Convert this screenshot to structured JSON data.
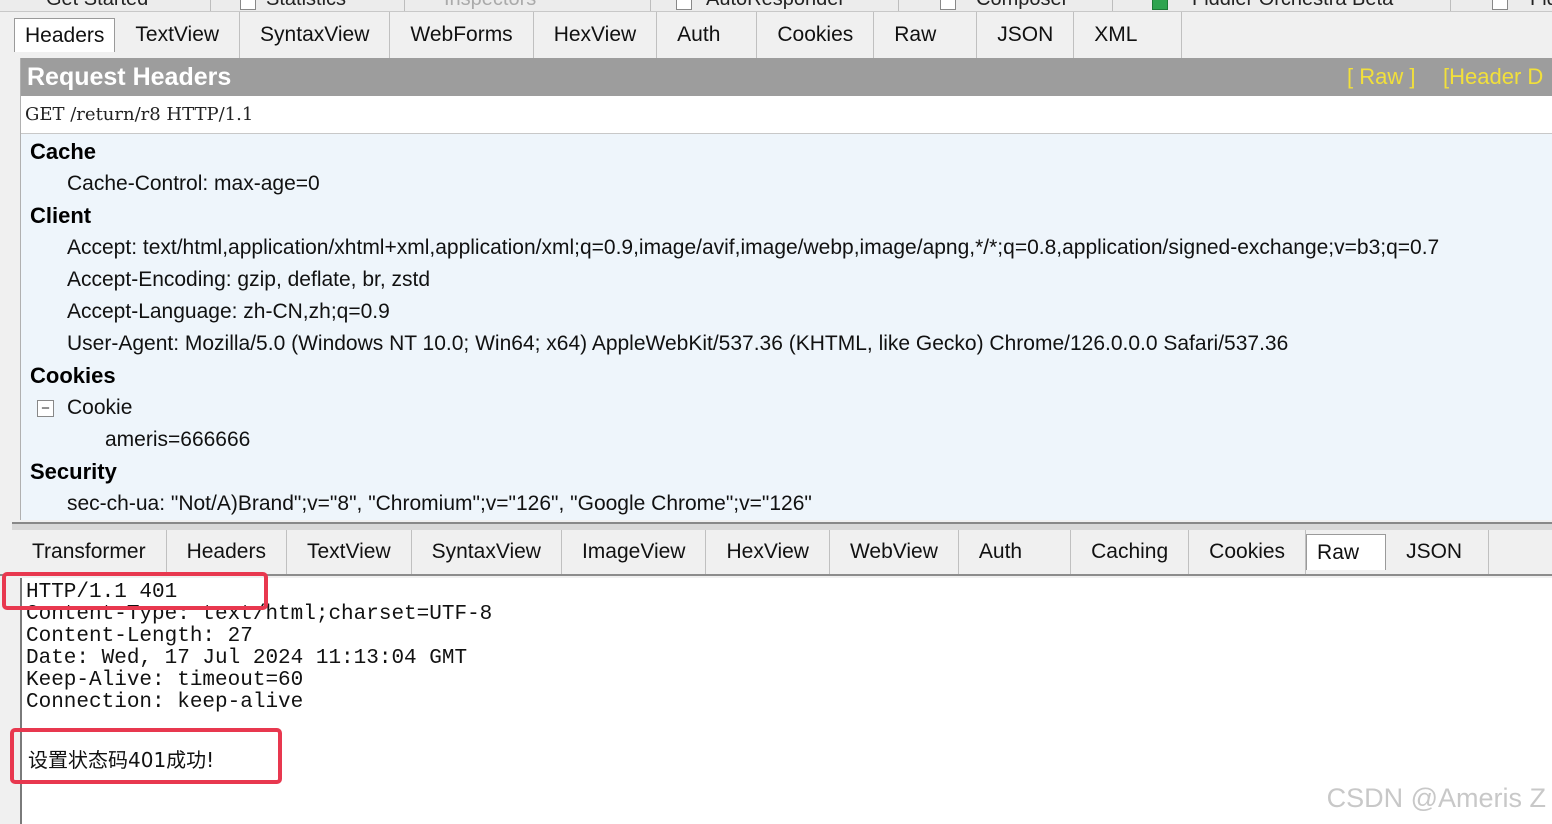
{
  "top_tabs": [
    "Get Started",
    "Statistics",
    "Inspectors",
    "AutoResponder",
    "Composer",
    "Fiddler Orchestra Beta",
    "FiddlerScript"
  ],
  "request_tabs": [
    "Headers",
    "TextView",
    "SyntaxView",
    "WebForms",
    "HexView",
    "Auth",
    "Cookies",
    "Raw",
    "JSON",
    "XML"
  ],
  "request": {
    "title": "Request Headers",
    "raw_link": "[ Raw ]",
    "header_defs_link": "[Header D",
    "request_line": "GET /return/r8 HTTP/1.1",
    "groups": {
      "cache": {
        "label": "Cache",
        "cache_control": "Cache-Control: max-age=0"
      },
      "client": {
        "label": "Client",
        "accept": "Accept: text/html,application/xhtml+xml,application/xml;q=0.9,image/avif,image/webp,image/apng,*/*;q=0.8,application/signed-exchange;v=b3;q=0.7",
        "accept_encoding": "Accept-Encoding: gzip, deflate, br, zstd",
        "accept_language": "Accept-Language: zh-CN,zh;q=0.9",
        "user_agent": "User-Agent: Mozilla/5.0 (Windows NT 10.0; Win64; x64) AppleWebKit/537.36 (KHTML, like Gecko) Chrome/126.0.0.0 Safari/537.36"
      },
      "cookies": {
        "label": "Cookies",
        "cookie_node": "Cookie",
        "expander": "−",
        "cookie_value": "ameris=666666"
      },
      "security": {
        "label": "Security",
        "sec_ch_ua": "sec-ch-ua: \"Not/A)Brand\";v=\"8\", \"Chromium\";v=\"126\", \"Google Chrome\";v=\"126\""
      }
    }
  },
  "response_tabs": [
    "Transformer",
    "Headers",
    "TextView",
    "SyntaxView",
    "ImageView",
    "HexView",
    "WebView",
    "Auth",
    "Caching",
    "Cookies",
    "Raw",
    "JSON"
  ],
  "response": {
    "raw_lines": [
      "HTTP/1.1 401",
      "Content-Type: text/html;charset=UTF-8",
      "Content-Length: 27",
      "Date: Wed, 17 Jul 2024 11:13:04 GMT",
      "Keep-Alive: timeout=60",
      "Connection: keep-alive"
    ],
    "body": "设置状态码401成功!"
  },
  "watermark": "CSDN @Ameris Z",
  "colors": {
    "highlight": "#e8384f",
    "title_bar": "#9d9d9d",
    "link_yellow": "#f2e03a"
  }
}
